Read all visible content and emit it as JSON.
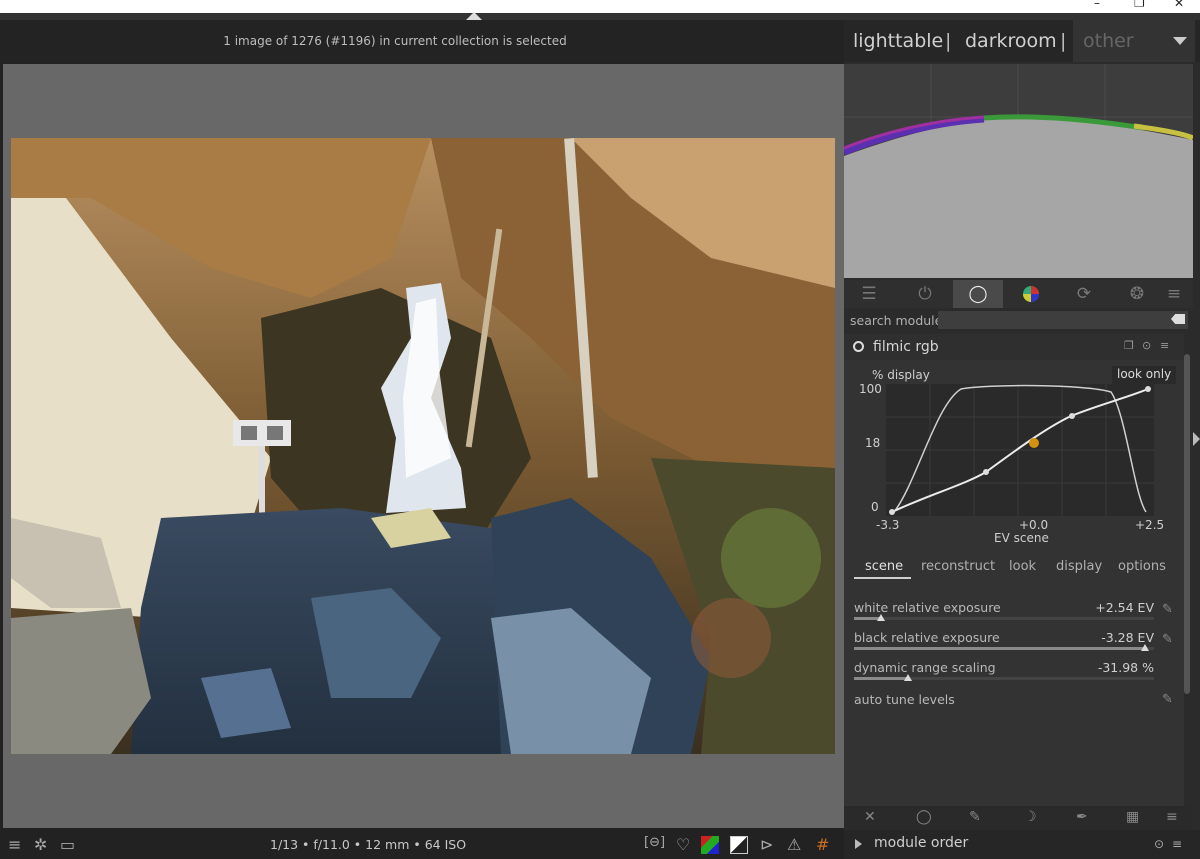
{
  "window": {
    "controls": [
      "–",
      "❐",
      "✕"
    ]
  },
  "header": {
    "collection_info": "1 image of 1276 (#1196) in current collection is selected"
  },
  "views": {
    "lighttable": "lighttable",
    "separator": "|",
    "darkroom": "darkroom",
    "other": "other"
  },
  "module_groups": {
    "icons": [
      "sliders-icon",
      "power-icon",
      "circle-icon",
      "color-wheel-icon",
      "refresh-circle-icon",
      "aperture-icon",
      "menu-icon"
    ],
    "active_index": 2
  },
  "search": {
    "label": "search module",
    "value": ""
  },
  "module": {
    "title": "filmic rgb",
    "graph": {
      "y_label": "% display",
      "x_label": "EV scene",
      "mode_badge": "look only",
      "y_ticks": [
        "100",
        "18",
        "0"
      ],
      "x_ticks": [
        "-3.3",
        "+0.0",
        "+2.5"
      ]
    },
    "tabs": [
      "scene",
      "reconstruct",
      "look",
      "display",
      "options"
    ],
    "active_tab": "scene",
    "sliders": [
      {
        "name": "white relative exposure",
        "value": "+2.54 EV",
        "fraction": 0.09
      },
      {
        "name": "black relative exposure",
        "value": "-3.28 EV",
        "fraction": 0.97
      },
      {
        "name": "dynamic range scaling",
        "value": "-31.98 %",
        "fraction": 0.18
      }
    ],
    "auto_tune": "auto tune levels"
  },
  "footer_icons": [
    "close-icon",
    "circle-icon",
    "brush-icon",
    "moon-icon",
    "pipette-icon",
    "checker-icon",
    "menu-icon"
  ],
  "bottom_bar": {
    "exif": "1/13 • f/11.0 • 12 mm • 64 ISO",
    "module_order": "module order"
  },
  "colors": {
    "accent_point": "#d4900f",
    "panel_bg": "#2b2b2b",
    "canvas_bg": "#686868"
  }
}
